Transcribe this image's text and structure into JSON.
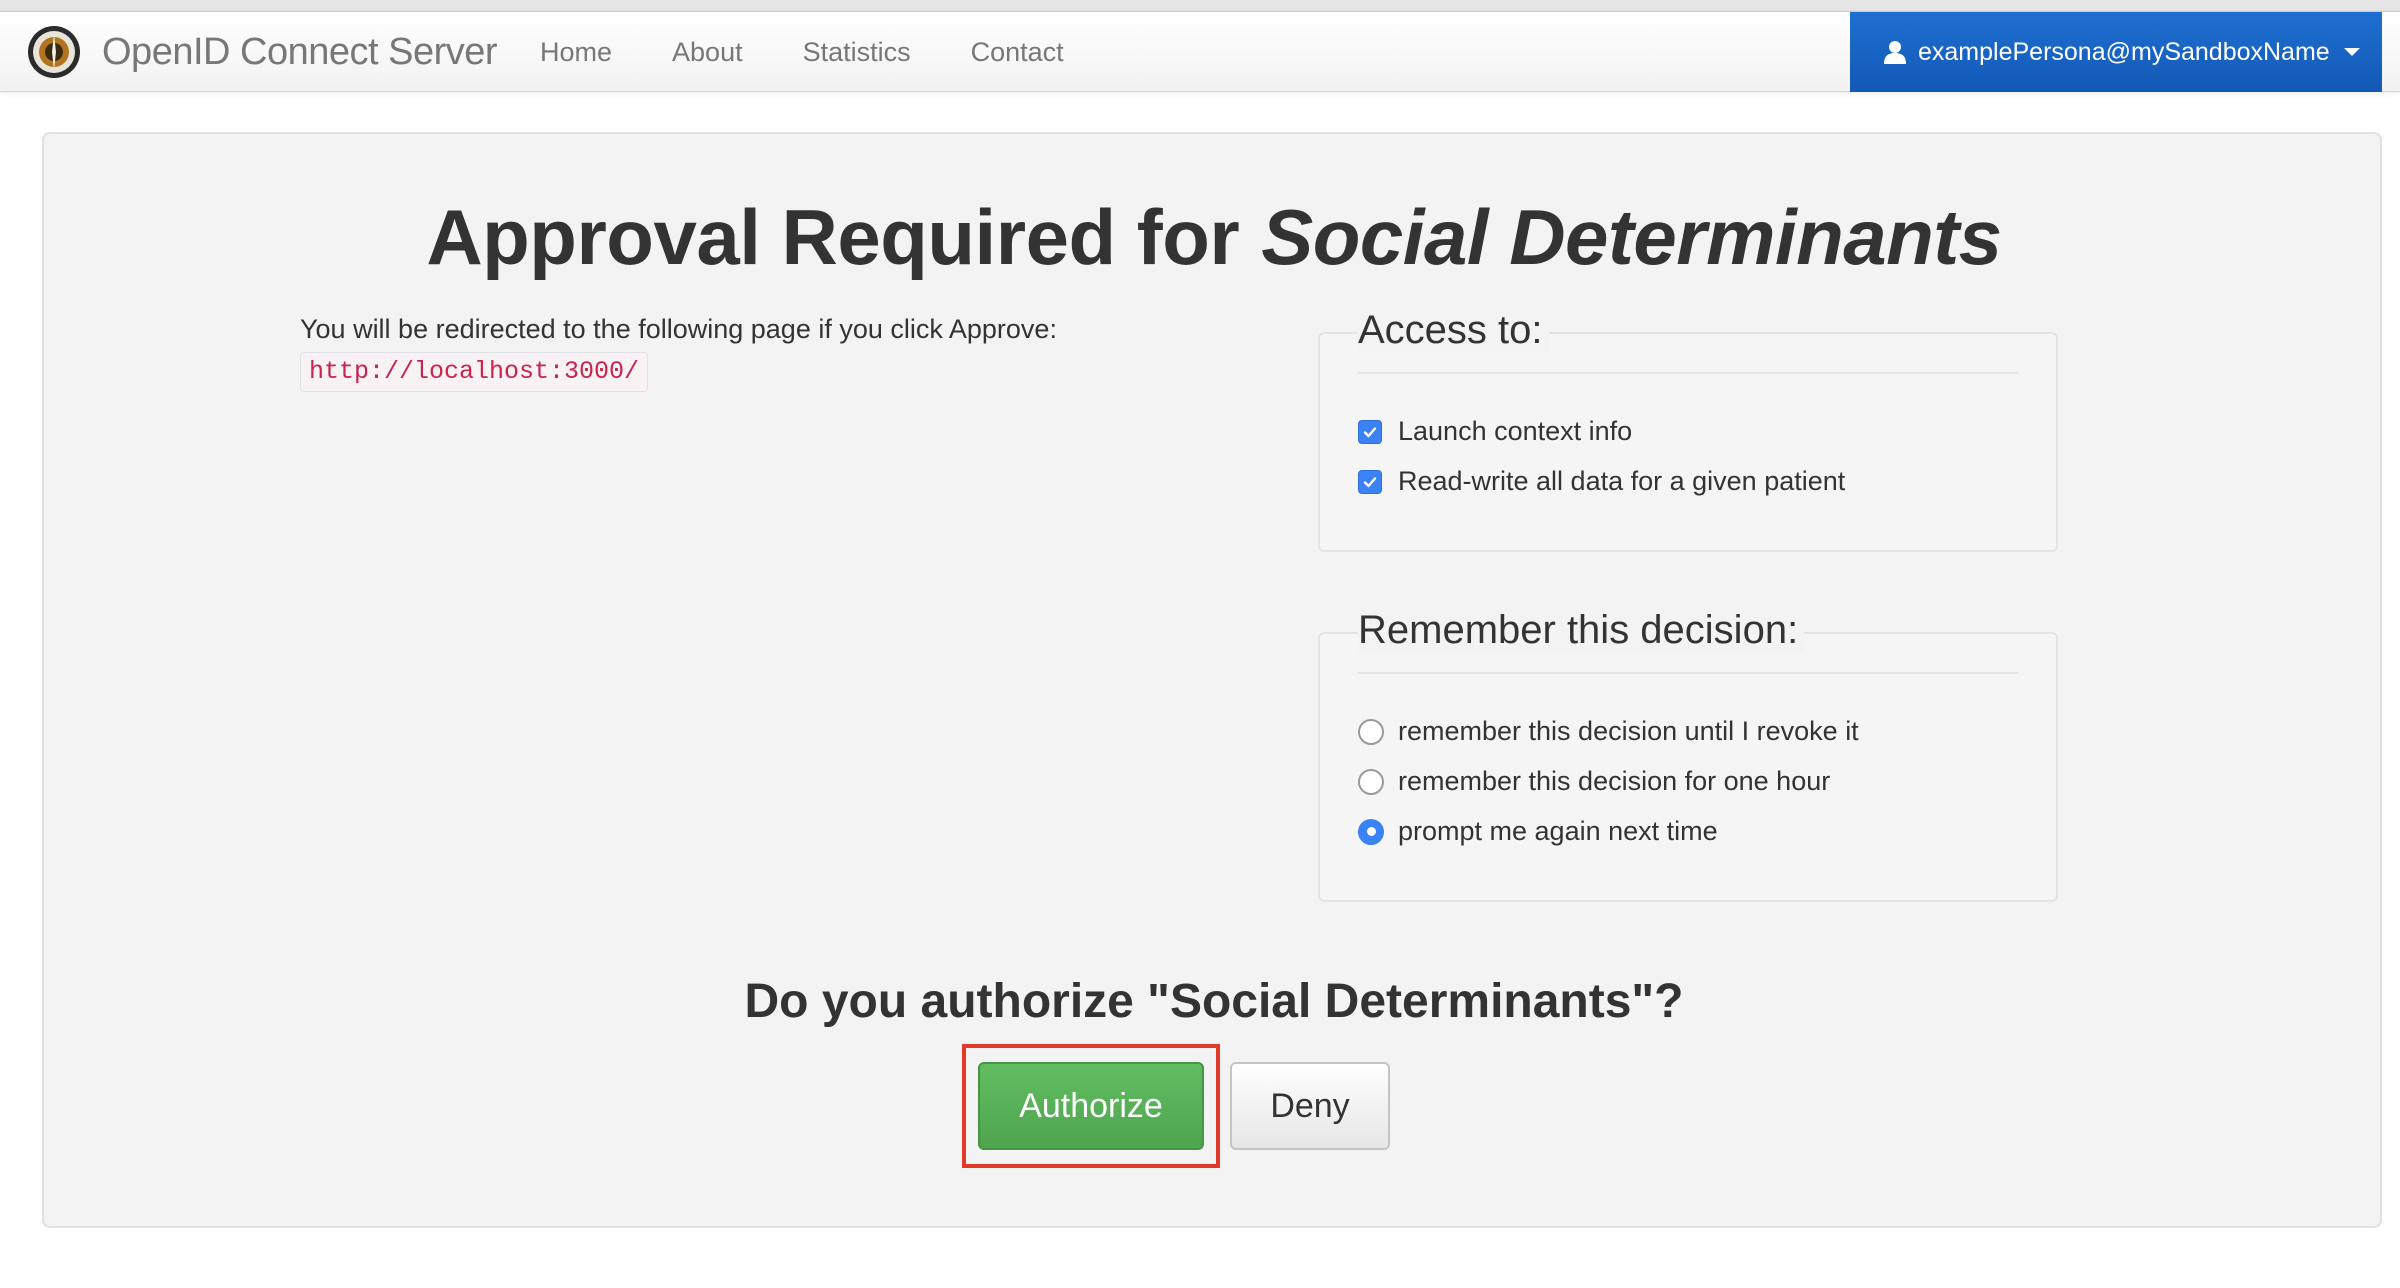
{
  "navbar": {
    "brand": "OpenID Connect Server",
    "links": [
      "Home",
      "About",
      "Statistics",
      "Contact"
    ],
    "user": "examplePersona@mySandboxName"
  },
  "approval": {
    "title_prefix": "Approval Required for",
    "client_name": "Social Determinants",
    "redirect_text": "You will be redirected to the following page if you click Approve:",
    "redirect_url": "http://localhost:3000/"
  },
  "access": {
    "legend": "Access to:",
    "scopes": [
      {
        "label": "Launch context info",
        "checked": true
      },
      {
        "label": "Read-write all data for a given patient",
        "checked": true
      }
    ]
  },
  "remember": {
    "legend": "Remember this decision:",
    "options": [
      {
        "label": "remember this decision until I revoke it",
        "selected": false
      },
      {
        "label": "remember this decision for one hour",
        "selected": false
      },
      {
        "label": "prompt me again next time",
        "selected": true
      }
    ]
  },
  "question": "Do you authorize \"Social Determinants\"?",
  "buttons": {
    "authorize": "Authorize",
    "deny": "Deny"
  },
  "colors": {
    "primary_nav": "#1a66c4",
    "authorize_green": "#5cb85c",
    "highlight_red": "#e23a2a",
    "checkbox_blue": "#3b82f6"
  }
}
